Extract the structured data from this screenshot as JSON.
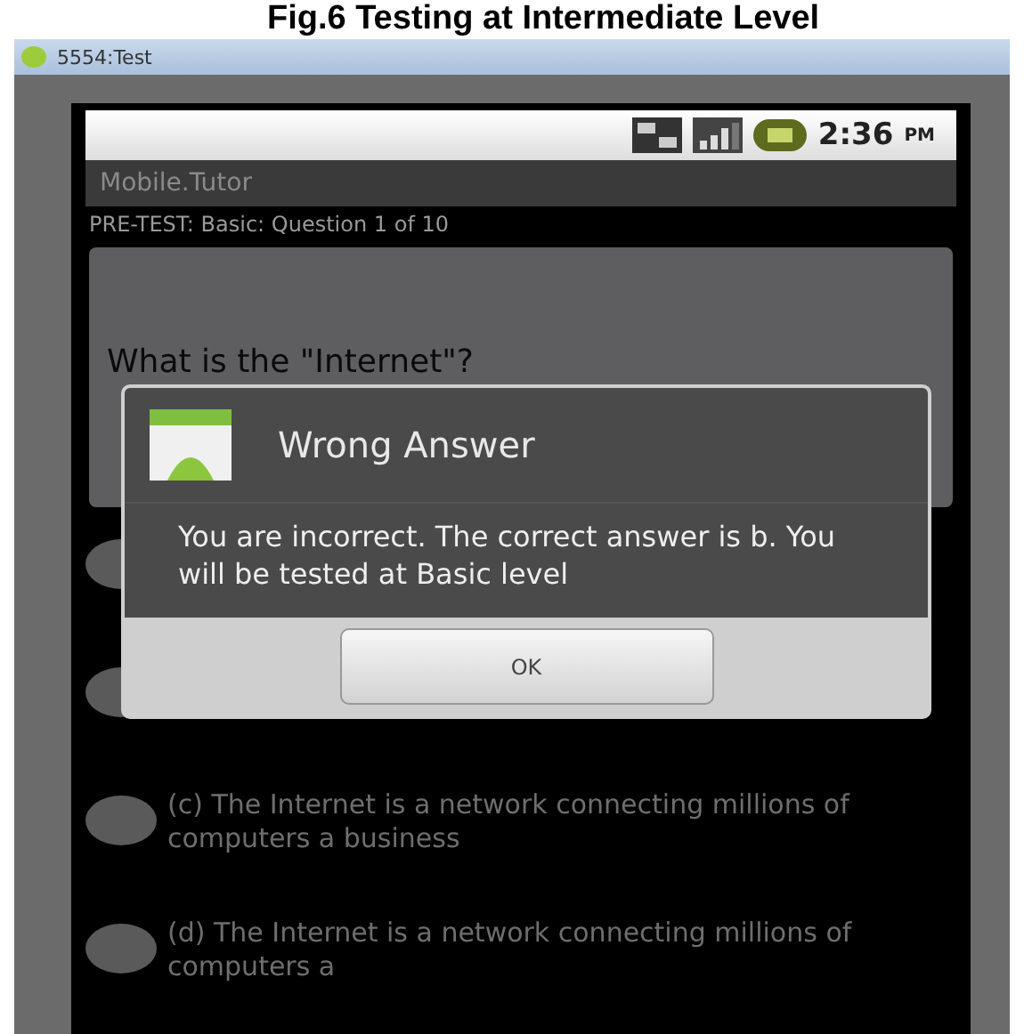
{
  "caption": "Fig.6 Testing at Intermediate Level",
  "window": {
    "title": "5554:Test"
  },
  "status_bar": {
    "time": "2:36",
    "meridiem": "PM"
  },
  "app": {
    "title": "Mobile.Tutor",
    "subtitle": "PRE-TEST: Basic: Question 1 of 10",
    "question": "What is the \"Internet\"?"
  },
  "options": [
    {
      "selected": false
    },
    {
      "selected": false
    },
    {
      "text": "(c) The Internet is a network connecting millions of computers a business",
      "selected": false
    },
    {
      "text": "(d) The Internet is a network connecting millions of computers a",
      "selected": false
    }
  ],
  "dialog": {
    "title": "Wrong Answer",
    "message": "You are incorrect. The correct answer is b. You will be tested at Basic level",
    "buttons": [
      "OK"
    ]
  }
}
